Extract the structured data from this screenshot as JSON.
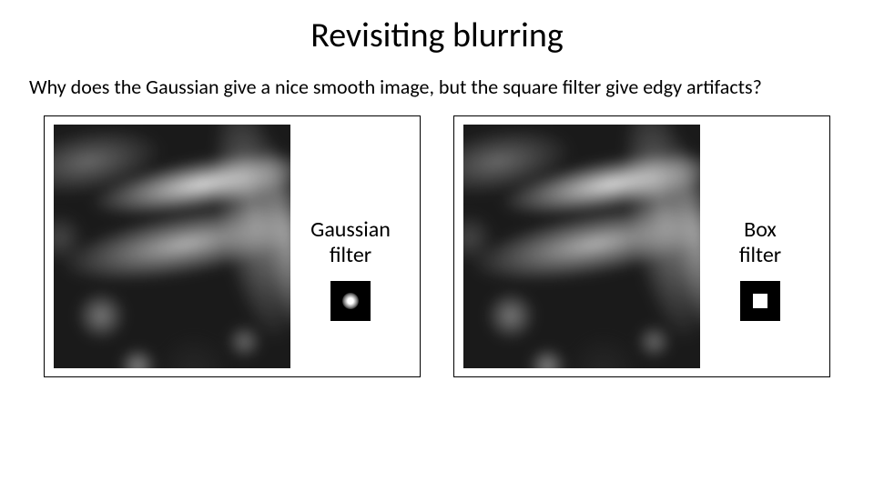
{
  "title": "Revisiting blurring",
  "question": "Why does the Gaussian give a nice smooth image, but the square filter give edgy artifacts?",
  "panels": {
    "left": {
      "label_line1": "Gaussian",
      "label_line2": "filter",
      "kernel_type": "gaussian"
    },
    "right": {
      "label_line1": "Box",
      "label_line2": "filter",
      "kernel_type": "box"
    }
  }
}
